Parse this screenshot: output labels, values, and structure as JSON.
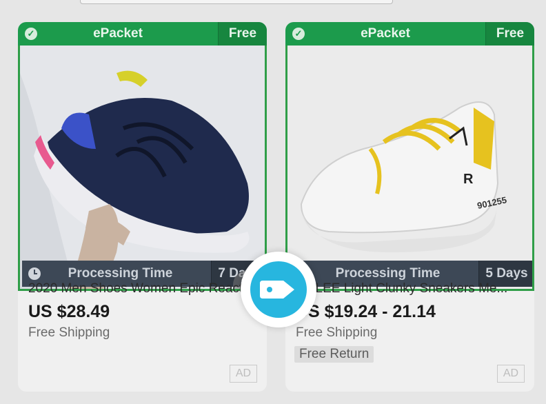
{
  "products": [
    {
      "shipping_method": "ePacket",
      "shipping_cost": "Free",
      "processing_label": "Processing Time",
      "processing_days": "7 Days",
      "title": "2020 Men Shoes Women Epic React",
      "price": "US $28.49",
      "shipping_note": "Free Shipping",
      "ad_label": "AD"
    },
    {
      "shipping_method": "ePacket",
      "shipping_cost": "Free",
      "processing_label": "Processing Time",
      "processing_days": "5 Days",
      "title": "ODLEE Light Clunky Sneakers Me...",
      "price": "US $19.24 - 21.14",
      "shipping_note": "Free Shipping",
      "return_note": "Free Return",
      "ad_label": "AD"
    }
  ],
  "colors": {
    "banner_green": "#1c9b4c",
    "processing_bar": "#3d4856",
    "fab_blue": "#27b6df"
  },
  "icons": {
    "check": "check-icon",
    "clock": "clock-icon",
    "heart": "heart-icon",
    "tag": "price-tag-icon"
  }
}
